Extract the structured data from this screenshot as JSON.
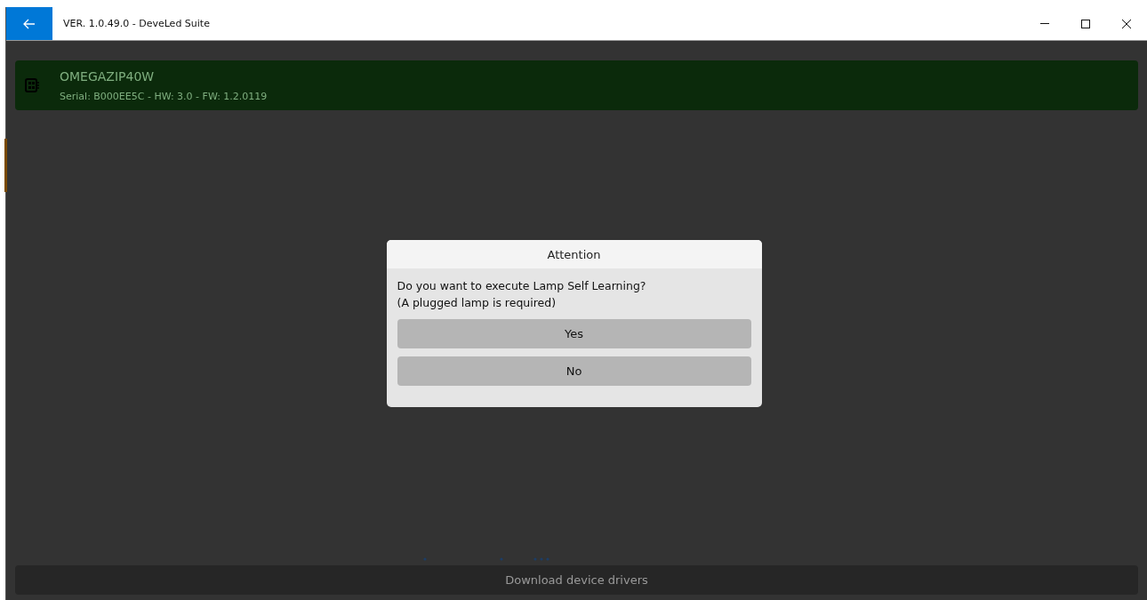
{
  "window": {
    "title": "VER. 1.0.49.0 - DeveLed Suite"
  },
  "device": {
    "name": "OMEGAZIP40W",
    "details": "Serial: B000EE5C - HW: 3.0 - FW: 1.2.0119"
  },
  "dialog": {
    "title": "Attention",
    "message": "Do you want to execute Lamp Self Learning?\n(A plugged lamp is required)",
    "buttons": [
      "Yes",
      "No"
    ]
  },
  "footer": {
    "button": "Download device drivers"
  }
}
